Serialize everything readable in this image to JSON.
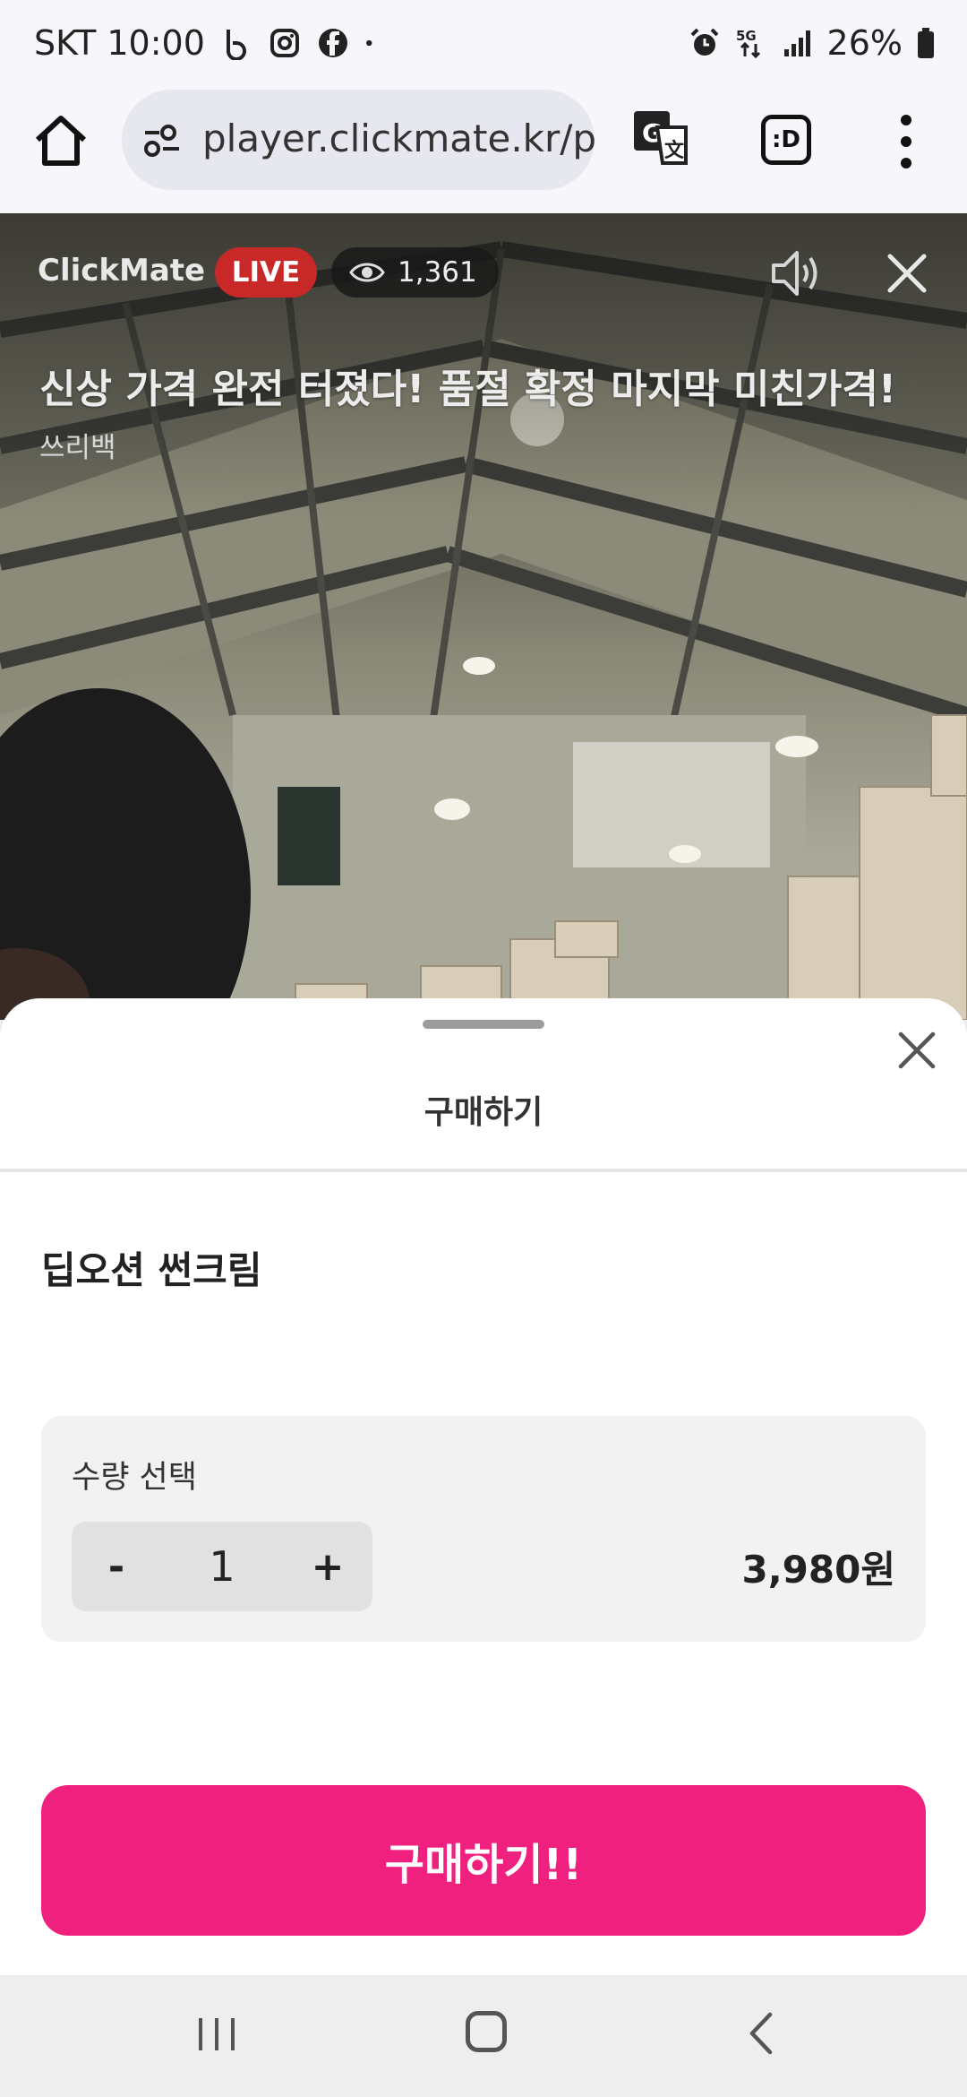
{
  "status_bar": {
    "carrier_time": "SKT 10:00",
    "battery": "26%",
    "network": "5G",
    "icons": [
      "b-app-icon",
      "instagram-icon",
      "facebook-icon",
      "dot-icon",
      "alarm-icon",
      "5g-icon",
      "signal-icon",
      "battery-icon"
    ]
  },
  "browser": {
    "url": "player.clickmate.kr/p",
    "tabs_label": ":D"
  },
  "video": {
    "brand": "ClickMate",
    "live_label": "LIVE",
    "viewer_count": "1,361",
    "title": "신상 가격 완전 터졌다! 품절 확정 마지막 미친가격!",
    "seller": "쓰리백"
  },
  "sheet": {
    "title": "구매하기",
    "product_name": "딥오션 썬크림",
    "quantity_label": "수량 선택",
    "minus_label": "-",
    "quantity": "1",
    "plus_label": "+",
    "price": "3,980원",
    "buy_button": "구매하기!!"
  },
  "colors": {
    "live_red": "#c92828",
    "buy_pink": "#f0207f",
    "qty_box_bg": "#f2f2f2"
  }
}
